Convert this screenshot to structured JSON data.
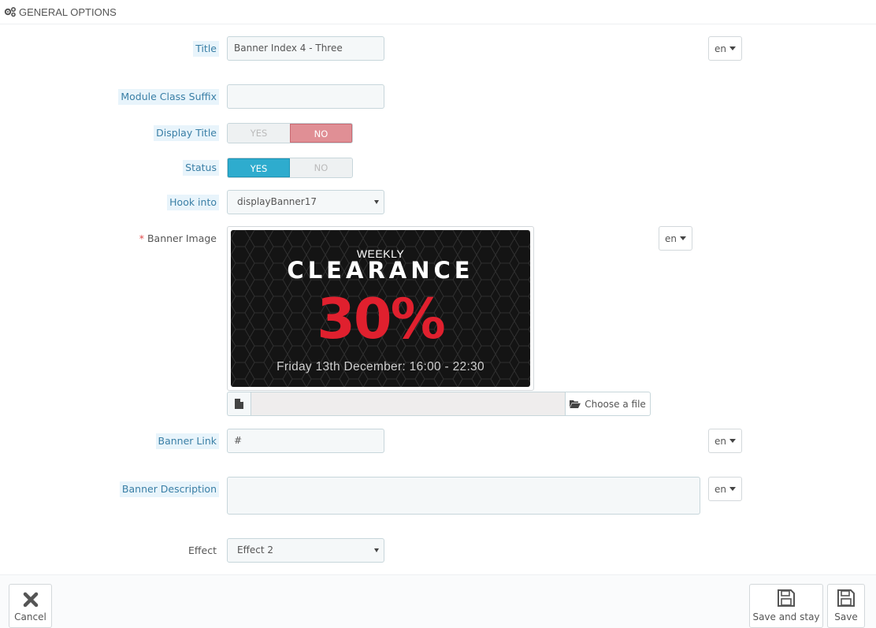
{
  "header": {
    "title": "GENERAL OPTIONS",
    "icon": "gears-icon"
  },
  "fields": {
    "title": {
      "label": "Title",
      "value": "Banner Index 4 - Three",
      "lang": "en"
    },
    "module_class_suffix": {
      "label": "Module Class Suffix",
      "value": ""
    },
    "display_title": {
      "label": "Display Title",
      "yes": "YES",
      "no": "NO",
      "selected": "NO"
    },
    "status": {
      "label": "Status",
      "yes": "YES",
      "no": "NO",
      "selected": "YES"
    },
    "hook_into": {
      "label": "Hook into",
      "selected": "displayBanner17"
    },
    "banner_image": {
      "label": "Banner Image",
      "required_mark": "*",
      "lang": "en",
      "preview": {
        "line1": "WEEKLY",
        "line2": "CLEARANCE",
        "line3": "30%",
        "line4": "Friday 13th December: 16:00 - 22:30"
      },
      "choose_label": "Choose a file"
    },
    "banner_link": {
      "label": "Banner Link",
      "value": "#",
      "lang": "en"
    },
    "banner_description": {
      "label": "Banner Description",
      "value": "",
      "lang": "en"
    },
    "effect": {
      "label": "Effect",
      "selected": "Effect 2"
    }
  },
  "footer": {
    "cancel": "Cancel",
    "save_and_stay": "Save and stay",
    "save": "Save"
  },
  "colors": {
    "hint_bg": "#e8f4fb",
    "switch_no": "#e08f95",
    "switch_yes": "#2eacce",
    "banner_accent": "#e0202e"
  }
}
